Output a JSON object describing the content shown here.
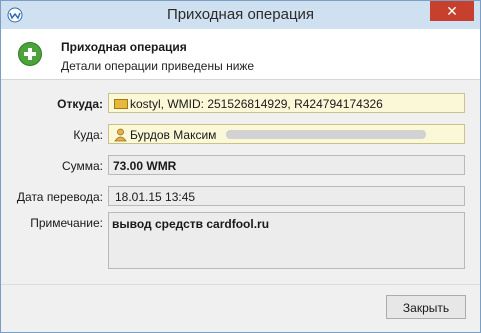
{
  "window": {
    "title": "Приходная операция"
  },
  "header": {
    "title": "Приходная операция",
    "subtitle": "Детали операции приведены ниже"
  },
  "form": {
    "from": {
      "label": "Откуда:",
      "value": "kostyl, WMID: 251526814929, R424794174326"
    },
    "to": {
      "label": "Куда:",
      "value": "Бурдов Максим"
    },
    "amount": {
      "label": "Сумма:",
      "value": "73.00 WMR"
    },
    "date": {
      "label": "Дата перевода:",
      "value": "18.01.15 13:45"
    },
    "note": {
      "label": "Примечание:",
      "value": "вывод средств cardfool.ru"
    }
  },
  "buttons": {
    "close_label": "Закрыть"
  },
  "colors": {
    "accent": "#4da33b",
    "close": "#c7402e",
    "titlebar": "#cfe0f0",
    "highlight": "#fbf8d8"
  }
}
